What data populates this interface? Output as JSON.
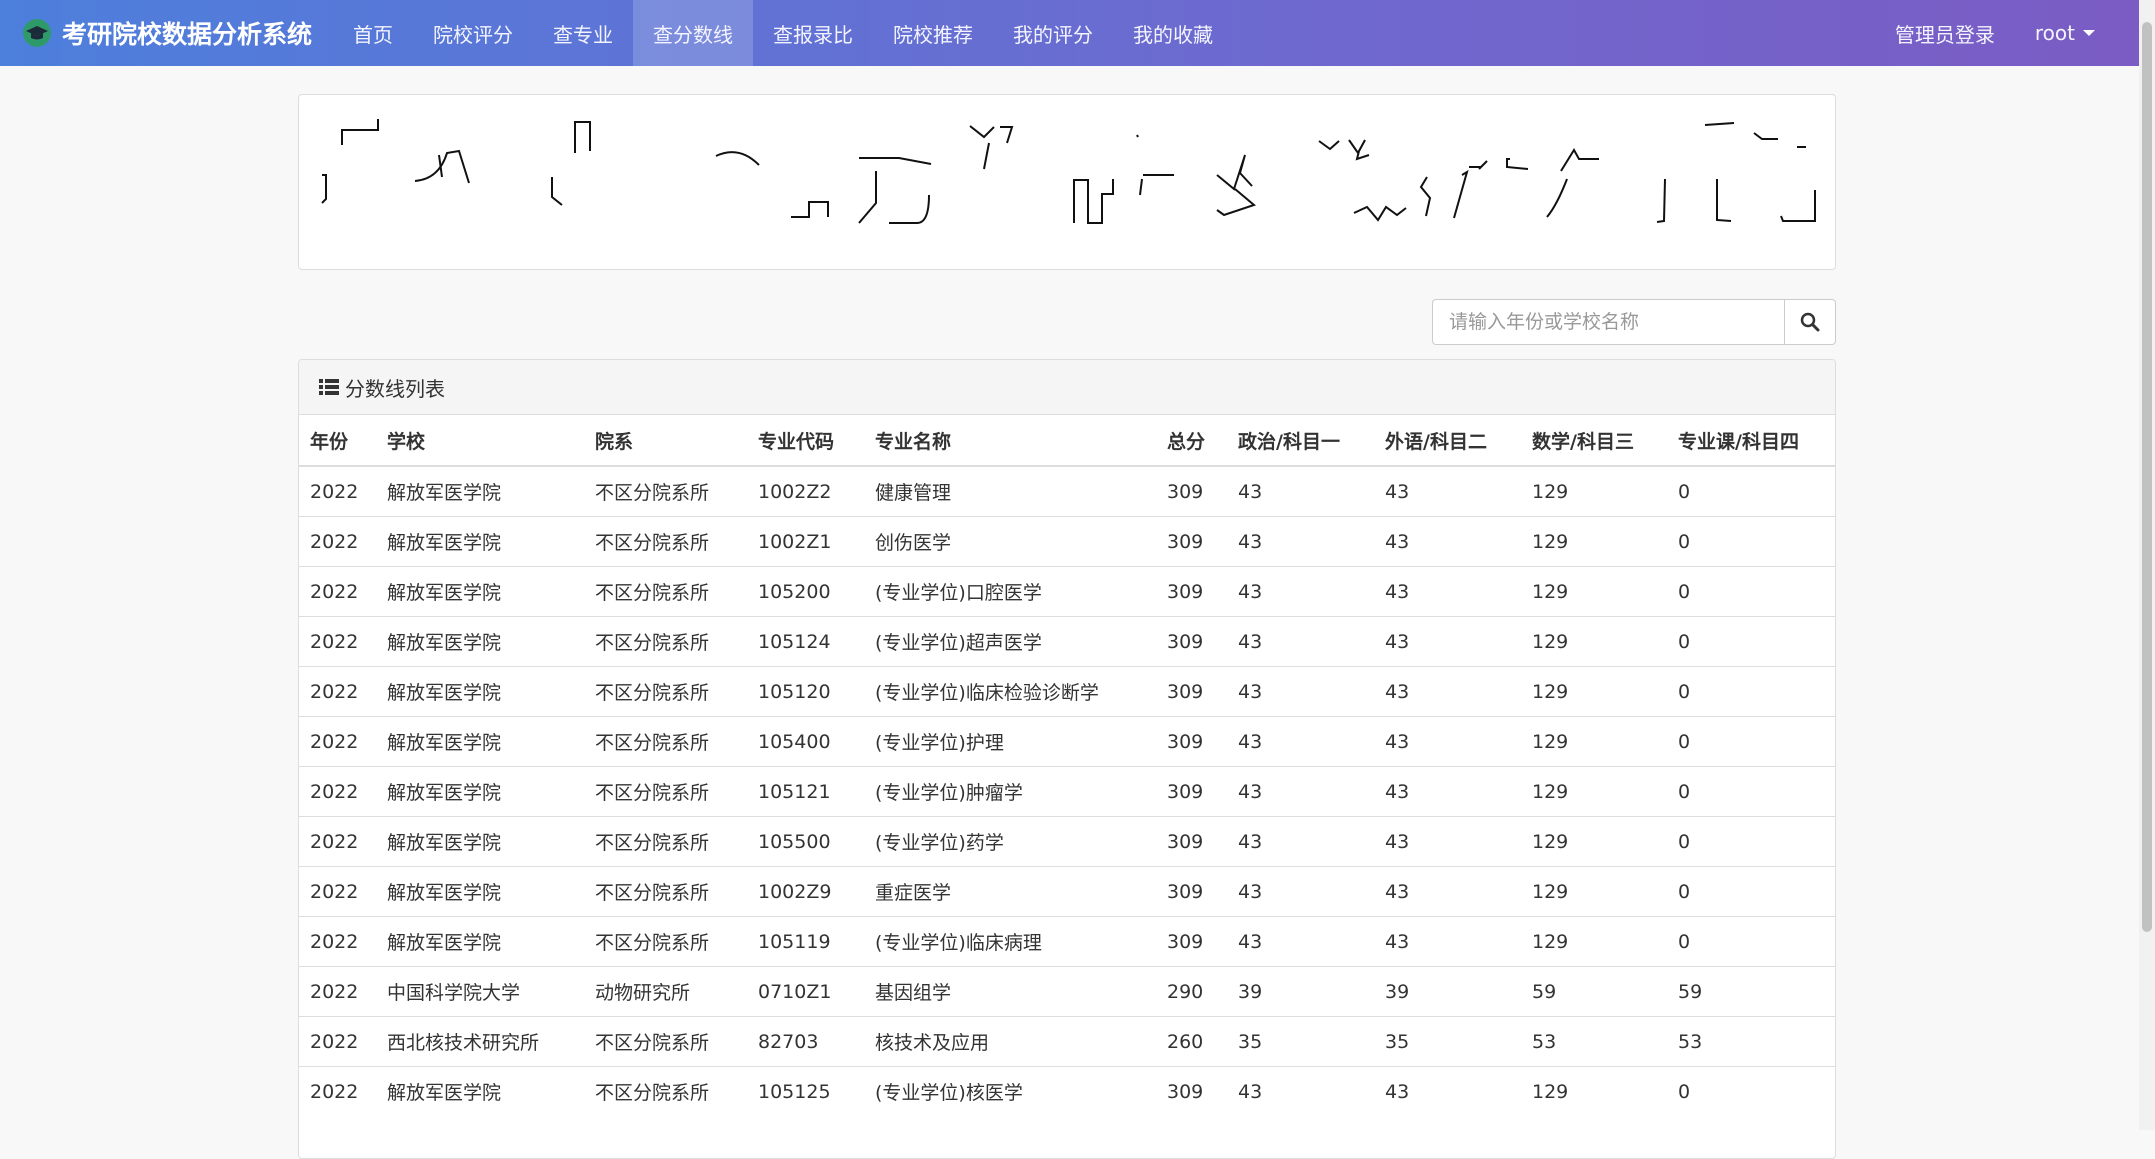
{
  "navbar": {
    "brand": "考研院校数据分析系统",
    "items": [
      {
        "label": "首页",
        "active": false
      },
      {
        "label": "院校评分",
        "active": false
      },
      {
        "label": "查专业",
        "active": false
      },
      {
        "label": "查分数线",
        "active": true
      },
      {
        "label": "查报录比",
        "active": false
      },
      {
        "label": "院校推荐",
        "active": false
      },
      {
        "label": "我的评分",
        "active": false
      },
      {
        "label": "我的收藏",
        "active": false
      }
    ],
    "admin_login": "管理员登录",
    "user": "root"
  },
  "search": {
    "placeholder": "请输入年份或学校名称",
    "icon": "search-icon"
  },
  "panel": {
    "title": "分数线列表",
    "icon": "list-icon"
  },
  "table": {
    "headers": [
      "年份",
      "学校",
      "院系",
      "专业代码",
      "专业名称",
      "总分",
      "政治/科目一",
      "外语/科目二",
      "数学/科目三",
      "专业课/科目四"
    ],
    "rows": [
      [
        "2022",
        "解放军医学院",
        "不区分院系所",
        "1002Z2",
        "健康管理",
        "309",
        "43",
        "43",
        "129",
        "0"
      ],
      [
        "2022",
        "解放军医学院",
        "不区分院系所",
        "1002Z1",
        "创伤医学",
        "309",
        "43",
        "43",
        "129",
        "0"
      ],
      [
        "2022",
        "解放军医学院",
        "不区分院系所",
        "105200",
        "(专业学位)口腔医学",
        "309",
        "43",
        "43",
        "129",
        "0"
      ],
      [
        "2022",
        "解放军医学院",
        "不区分院系所",
        "105124",
        "(专业学位)超声医学",
        "309",
        "43",
        "43",
        "129",
        "0"
      ],
      [
        "2022",
        "解放军医学院",
        "不区分院系所",
        "105120",
        "(专业学位)临床检验诊断学",
        "309",
        "43",
        "43",
        "129",
        "0"
      ],
      [
        "2022",
        "解放军医学院",
        "不区分院系所",
        "105400",
        "(专业学位)护理",
        "309",
        "43",
        "43",
        "129",
        "0"
      ],
      [
        "2022",
        "解放军医学院",
        "不区分院系所",
        "105121",
        "(专业学位)肿瘤学",
        "309",
        "43",
        "43",
        "129",
        "0"
      ],
      [
        "2022",
        "解放军医学院",
        "不区分院系所",
        "105500",
        "(专业学位)药学",
        "309",
        "43",
        "43",
        "129",
        "0"
      ],
      [
        "2022",
        "解放军医学院",
        "不区分院系所",
        "1002Z9",
        "重症医学",
        "309",
        "43",
        "43",
        "129",
        "0"
      ],
      [
        "2022",
        "解放军医学院",
        "不区分院系所",
        "105119",
        "(专业学位)临床病理",
        "309",
        "43",
        "43",
        "129",
        "0"
      ],
      [
        "2022",
        "中国科学院大学",
        "动物研究所",
        "0710Z1",
        "基因组学",
        "290",
        "39",
        "39",
        "59",
        "59"
      ],
      [
        "2022",
        "西北核技术研究所",
        "不区分院系所",
        "82703",
        "核技术及应用",
        "260",
        "35",
        "35",
        "53",
        "53"
      ],
      [
        "2022",
        "解放军医学院",
        "不区分院系所",
        "105125",
        "(专业学位)核医学",
        "309",
        "43",
        "43",
        "129",
        "0"
      ]
    ]
  }
}
